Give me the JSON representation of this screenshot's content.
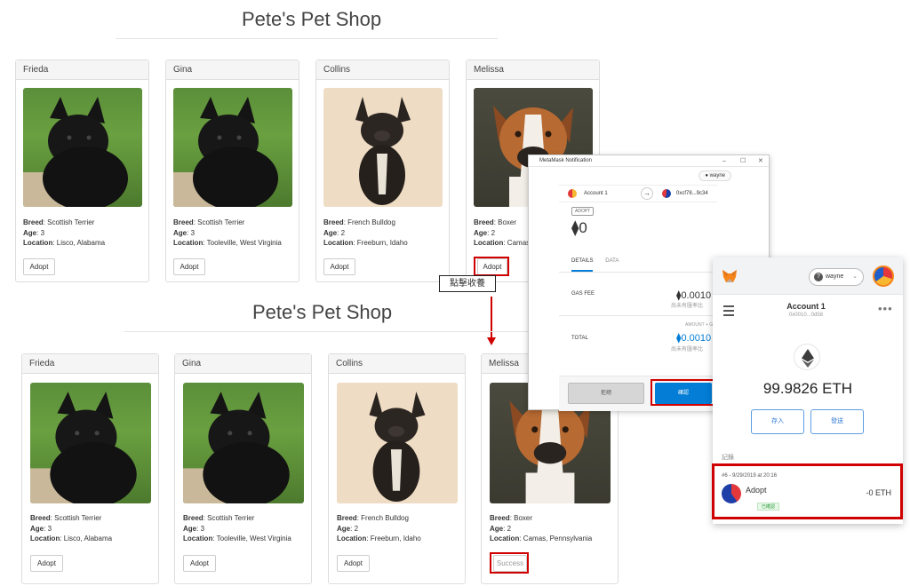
{
  "shop_top": {
    "title": "Pete's Pet Shop",
    "pets": [
      {
        "name": "Frieda",
        "breed": "Scottish Terrier",
        "age": "3",
        "location": "Lisco, Alabama",
        "button": "Adopt"
      },
      {
        "name": "Gina",
        "breed": "Scottish Terrier",
        "age": "3",
        "location": "Tooleville, West Virginia",
        "button": "Adopt"
      },
      {
        "name": "Collins",
        "breed": "French Bulldog",
        "age": "2",
        "location": "Freeburn, Idaho",
        "button": "Adopt"
      },
      {
        "name": "Melissa",
        "breed": "Boxer",
        "age": "2",
        "location": "Camas",
        "button": "Adopt"
      }
    ]
  },
  "shop_bottom": {
    "title": "Pete's Pet Shop",
    "pets": [
      {
        "name": "Frieda",
        "breed": "Scottish Terrier",
        "age": "3",
        "location": "Lisco, Alabama",
        "button": "Adopt"
      },
      {
        "name": "Gina",
        "breed": "Scottish Terrier",
        "age": "3",
        "location": "Tooleville, West Virginia",
        "button": "Adopt"
      },
      {
        "name": "Collins",
        "breed": "French Bulldog",
        "age": "2",
        "location": "Freeburn, Idaho",
        "button": "Adopt"
      },
      {
        "name": "Melissa",
        "breed": "Boxer",
        "age": "2",
        "location": "Camas, Pennsylvania",
        "button": "Success"
      }
    ]
  },
  "labels": {
    "breed": "Breed",
    "age": "Age",
    "location": "Location"
  },
  "annotation": {
    "note": "點擊收養"
  },
  "notification": {
    "window_title": "MetaMask Notification",
    "network": "wayne",
    "from_account": "Account 1",
    "to_address": "0xcf78...9c34",
    "tag": "ADOPT",
    "amount": "0",
    "tabs": [
      "DETAILS",
      "DATA"
    ],
    "gas_fee_label": "GAS FEE",
    "gas_fee_value": "0.0010",
    "gas_fee_sub": "尚未有匯率比",
    "amount_gas_label": "AMOUNT + GAS",
    "total_label": "TOTAL",
    "total_value": "0.0010",
    "total_sub": "尚未有匯率比",
    "reject": "拒絕",
    "confirm": "確認",
    "controls": {
      "minimize": "–",
      "maximize": "☐",
      "close": "✕"
    }
  },
  "wallet": {
    "network": "wayne",
    "account_name": "Account 1",
    "address": "0x0010...0d58",
    "balance": "99.9826 ETH",
    "deposit": "存入",
    "send": "發送",
    "history_label": "記錄",
    "transaction": {
      "meta": "#6 - 9/29/2019 at 20:16",
      "name": "Adopt",
      "status": "已確認",
      "amount": "-0 ETH"
    }
  },
  "colors": {
    "accent_red": "#d10000",
    "metamask_blue": "#037dd6",
    "fox_orange": "#f6851b"
  }
}
